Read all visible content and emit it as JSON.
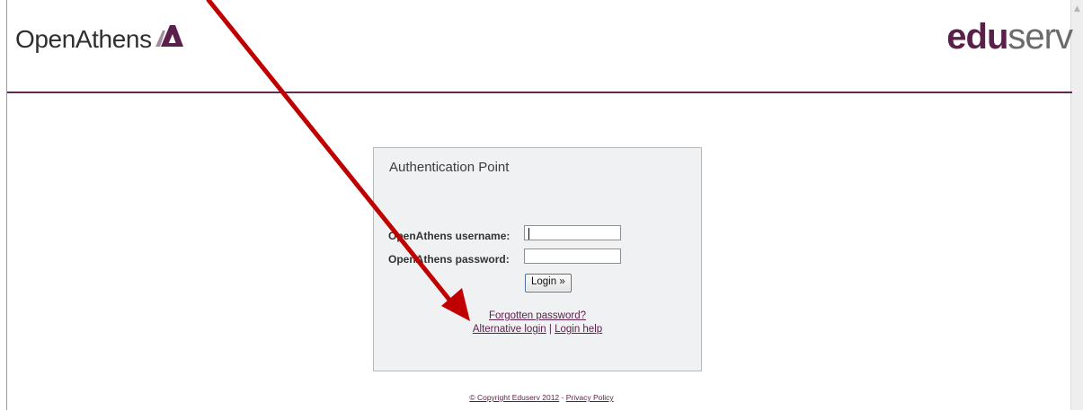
{
  "header": {
    "brand": "OpenAthens",
    "partner_a": "edu",
    "partner_b": "serv"
  },
  "panel": {
    "title": "Authentication Point",
    "username_label": "OpenAthens username:",
    "password_label": "OpenAthens password:",
    "username_value": "",
    "password_value": "",
    "login_button": "Login »",
    "forgot_link": "Forgotten password?",
    "alt_login_link": "Alternative login",
    "separator": "|",
    "help_link": "Login help"
  },
  "footer": {
    "copyright": "© Copyright Eduserv 2012",
    "dash": "-",
    "privacy": "Privacy Policy"
  },
  "colors": {
    "brand": "#5a1f4a",
    "rule": "#62284f",
    "arrow": "#c00000",
    "panel_bg": "#f0f1f3"
  },
  "icons": {
    "logo": "openathens-logo-icon",
    "arrow": "red-pointer-arrow",
    "scroll_up": "scroll-up-arrow-icon"
  }
}
